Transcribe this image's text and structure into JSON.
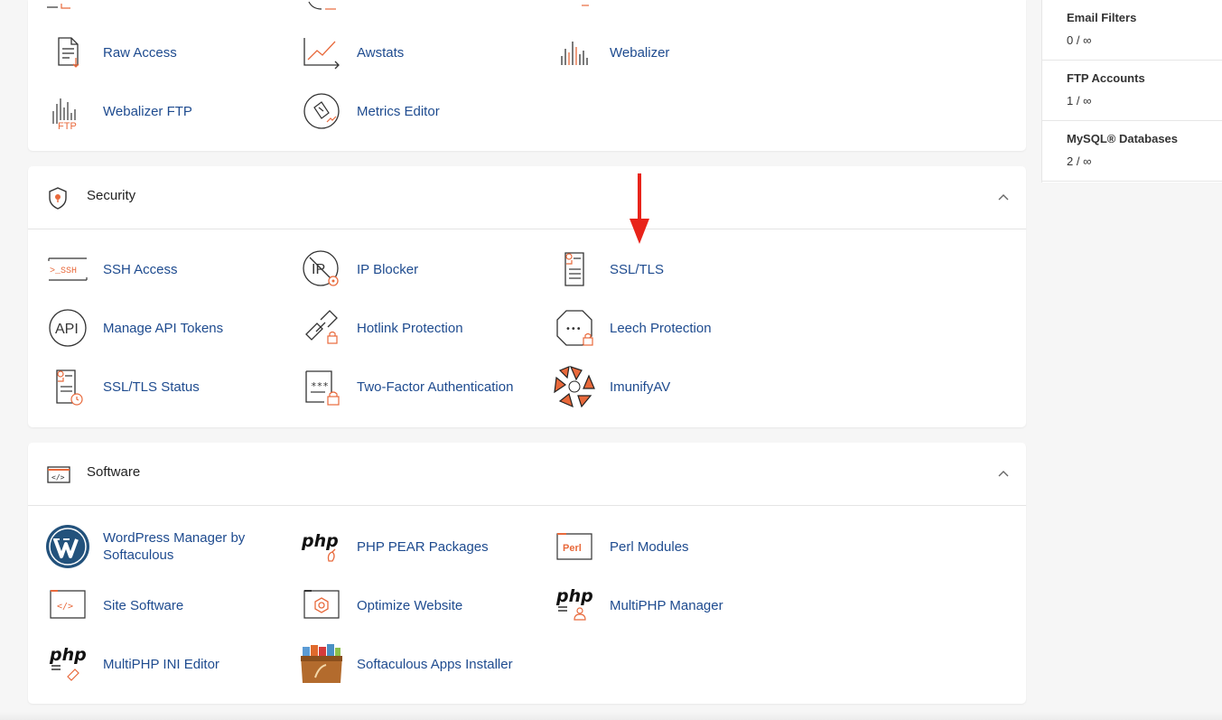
{
  "stats_panel": {
    "items": [
      {
        "label": "Email Filters",
        "value": "0 / ∞"
      },
      {
        "label": "FTP Accounts",
        "value": "1 / ∞"
      },
      {
        "label": "MySQL® Databases",
        "value": "2 / ∞"
      }
    ]
  },
  "metrics": {
    "items": [
      {
        "label": "Raw Access",
        "icon": "raw-access-icon"
      },
      {
        "label": "Awstats",
        "icon": "awstats-icon"
      },
      {
        "label": "Webalizer",
        "icon": "webalizer-icon"
      },
      {
        "label": "Webalizer FTP",
        "icon": "webalizer-ftp-icon"
      },
      {
        "label": "Metrics Editor",
        "icon": "metrics-editor-icon"
      }
    ]
  },
  "security": {
    "title": "Security",
    "items": [
      {
        "label": "SSH Access",
        "icon": "ssh-icon"
      },
      {
        "label": "IP Blocker",
        "icon": "ip-blocker-icon"
      },
      {
        "label": "SSL/TLS",
        "icon": "ssl-tls-icon"
      },
      {
        "label": "Manage API Tokens",
        "icon": "api-icon"
      },
      {
        "label": "Hotlink Protection",
        "icon": "hotlink-icon"
      },
      {
        "label": "Leech Protection",
        "icon": "leech-icon"
      },
      {
        "label": "SSL/TLS Status",
        "icon": "ssl-status-icon"
      },
      {
        "label": "Two-Factor Authentication",
        "icon": "two-factor-icon"
      },
      {
        "label": "ImunifyAV",
        "icon": "imunify-icon"
      }
    ]
  },
  "software": {
    "title": "Software",
    "items": [
      {
        "label": "WordPress Manager by\nSoftaculous",
        "icon": "wordpress-icon"
      },
      {
        "label": "PHP PEAR Packages",
        "icon": "php-pear-icon"
      },
      {
        "label": "Perl Modules",
        "icon": "perl-icon"
      },
      {
        "label": "Site Software",
        "icon": "site-software-icon"
      },
      {
        "label": "Optimize Website",
        "icon": "optimize-icon"
      },
      {
        "label": "MultiPHP Manager",
        "icon": "multiphp-manager-icon"
      },
      {
        "label": "MultiPHP INI Editor",
        "icon": "multiphp-ini-icon"
      },
      {
        "label": "Softaculous Apps Installer",
        "icon": "softaculous-icon"
      }
    ]
  },
  "icon_text": {
    "ssh": ">_SSH",
    "ip": "IP",
    "api": "API",
    "php": "php",
    "perl": "Perl",
    "code": "</>",
    "dots": "•••",
    "pwd": "***",
    "ftp": "FTP"
  },
  "colors": {
    "accent": "#e8693b",
    "link": "#1e4b8f",
    "annotation_arrow": "#e8231a"
  }
}
